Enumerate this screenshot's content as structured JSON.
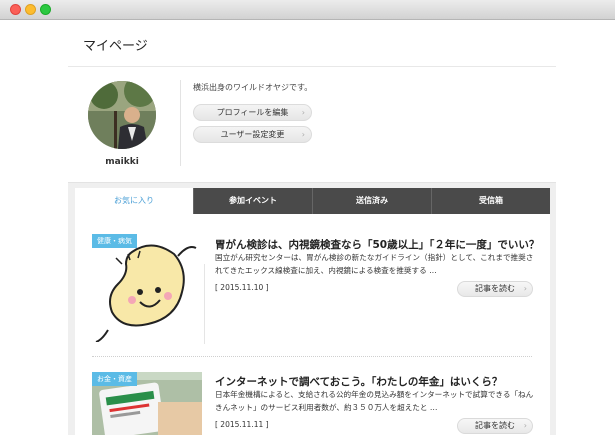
{
  "page": {
    "title": "マイページ"
  },
  "profile": {
    "username": "maikki",
    "bio": "横浜出身のワイルドオヤジです。",
    "buttons": {
      "edit_profile": "プロフィールを編集",
      "user_settings": "ユーザー設定変更"
    },
    "button_arrow": "›"
  },
  "tabs": [
    {
      "label": "お気に入り",
      "active": true
    },
    {
      "label": "参加イベント",
      "active": false
    },
    {
      "label": "送信済み",
      "active": false
    },
    {
      "label": "受信箱",
      "active": false
    }
  ],
  "articles": [
    {
      "category": "健康・病気",
      "title": "胃がん検診は、内視鏡検査なら「50歳以上」「２年に一度」でいい？",
      "body": "国立がん研究センターは、胃がん検診の新たなガイドライン（指針）として、これまで推奨されてきたエックス線検査に加え、内視鏡による検査を推奨する …",
      "date": "[ 2015.11.10 ]",
      "read_label": "記事を読む"
    },
    {
      "category": "お金・資産",
      "title": "インターネットで調べておこう。「わたしの年金」はいくら？",
      "body": "日本年金機構によると、支給される公的年金の見込み額をインターネットで試算できる「ねんきんネット」のサービス利用者数が、約３５０万人を超えたと …",
      "date": "[ 2015.11.11 ]",
      "read_label": "記事を読む"
    }
  ],
  "colors": {
    "accent": "#4a9fd6",
    "tab_dark": "#4a4a4a",
    "badge": "#5bbbe6"
  }
}
